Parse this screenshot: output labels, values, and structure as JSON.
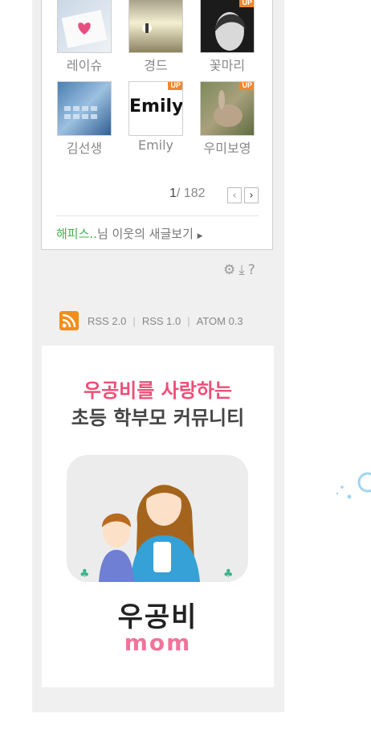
{
  "neighbors": [
    {
      "name": "레이슈",
      "up": false
    },
    {
      "name": "경드",
      "up": false
    },
    {
      "name": "꽃마리",
      "up": true
    },
    {
      "name": "김선생",
      "up": false
    },
    {
      "name": "Emily",
      "up": true
    },
    {
      "name": "우미보영",
      "up": true
    }
  ],
  "thumb_text": {
    "emily": "Emily"
  },
  "badge_label": "UP",
  "pager": {
    "current": "1",
    "total": "/ 182",
    "prev_icon": "chevron-left-icon",
    "next_icon": "chevron-right-icon",
    "prev_glyph": "‹",
    "next_glyph": "›"
  },
  "new_posts": {
    "nick": "해피스..",
    "text": "님 이웃의 새글보기"
  },
  "tools": {
    "settings_glyph": "⚙",
    "download_glyph": "⤓",
    "help_glyph": "?"
  },
  "feeds": {
    "rss2": "RSS 2.0",
    "rss1": "RSS 1.0",
    "atom": "ATOM 0.3",
    "sep": "|"
  },
  "ad": {
    "line1": "우공비를 사랑하는",
    "line2": "초등 학부모 커뮤니티",
    "logo_top": "우공비",
    "logo_bottom": "mom"
  },
  "colors": {
    "accent_green": "#3fb14d",
    "badge_orange": "#f3872c",
    "ad_pink": "#ef4e77",
    "rss_orange": "#f28d1b"
  }
}
